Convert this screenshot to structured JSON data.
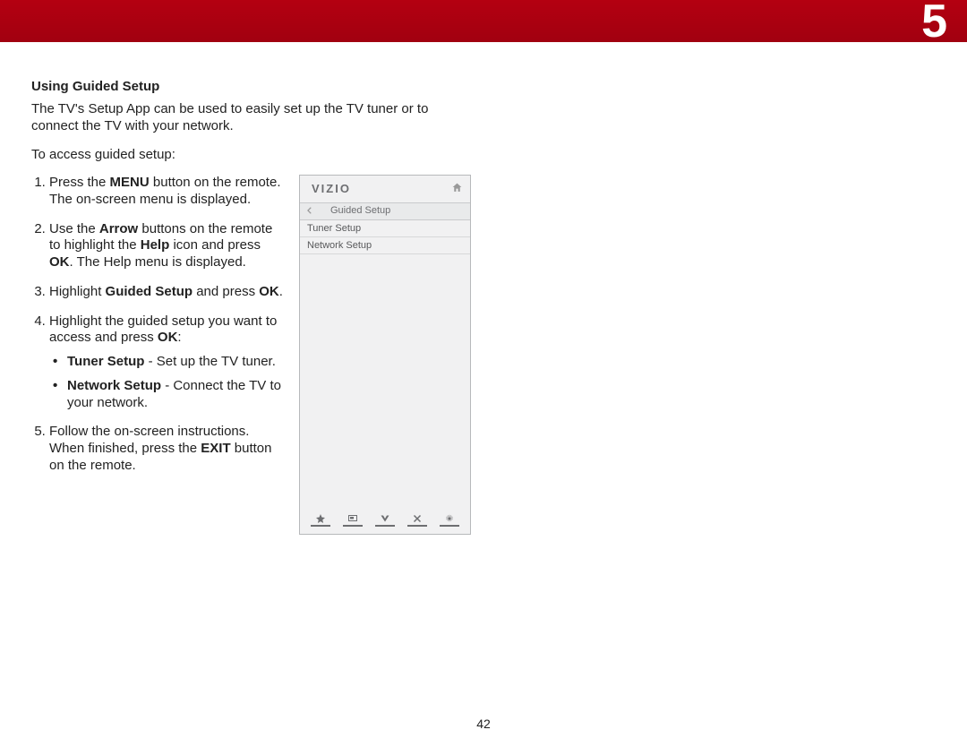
{
  "header": {
    "chapter": "5"
  },
  "body": {
    "heading": "Using Guided Setup",
    "intro": "The TV's Setup App can be used to easily set up the TV tuner or to connect the TV with your network.",
    "leadin": "To access guided setup:",
    "steps": [
      {
        "a": "Press the",
        "b": "MENU",
        "c": "button on the remote. The on-screen menu is displayed."
      },
      {
        "a": "Use the",
        "b": "Arrow",
        "c": "buttons on the remote to highlight the",
        "d": "Help",
        "e": "icon and press",
        "f": "OK",
        "g": ". The Help menu is displayed."
      },
      {
        "a": "Highlight",
        "b": "Guided Setup",
        "c": "and press",
        "d": "OK",
        "e": "."
      },
      {
        "a": "Highlight the guided setup you want to access and press",
        "b": "OK",
        "c": ":"
      },
      {
        "a": "Follow the on-screen instructions. When finished, press the",
        "b": "EXIT",
        "c": "button on the remote."
      }
    ],
    "bullets": [
      {
        "title": "Tuner Setup",
        "desc": "- Set up the TV tuner."
      },
      {
        "title": "Network Setup",
        "desc": "- Connect the TV to your network."
      }
    ]
  },
  "panel": {
    "brand": "VIZIO",
    "crumb": "Guided Setup",
    "items": [
      "Tuner Setup",
      "Network Setup"
    ]
  },
  "footer": {
    "page": "42"
  }
}
